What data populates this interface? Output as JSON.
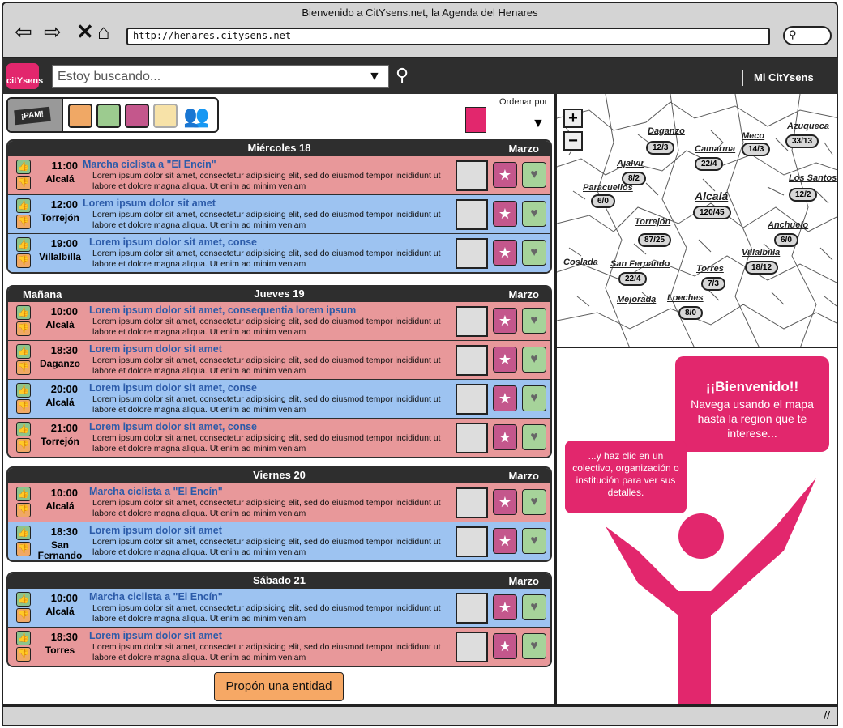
{
  "browser": {
    "title": "Bienvenido a CitYsens.net, la Agenda del Henares",
    "url": "http://henares.citysens.net"
  },
  "app": {
    "logo_text": "citYsens",
    "search_placeholder": "Estoy buscando...",
    "my_link": "Mi CitYsens",
    "sort_label": "Ordenar por",
    "pam_label": "¡PAM!",
    "propose_button": "Propón una entidad"
  },
  "days": [
    {
      "left": "",
      "name": "Miércoles 18",
      "month": "Marzo",
      "events": [
        {
          "color": "red",
          "time": "11:00",
          "place": "Alcalá",
          "title": "Marcha ciclista a \"El Encín\"",
          "desc": "Lorem ipsum dolor sit amet, consectetur adipisicing elit, sed do eiusmod tempor incididunt ut labore et dolore magna aliqua. Ut enim ad minim veniam"
        },
        {
          "color": "blue",
          "time": "12:00",
          "place": "Torrejón",
          "title": "Lorem ipsum dolor sit amet",
          "desc": "Lorem ipsum dolor sit amet, consectetur adipisicing elit, sed do eiusmod tempor incididunt ut labore et dolore magna aliqua. Ut enim ad minim veniam"
        },
        {
          "color": "blue",
          "time": "19:00",
          "place": "Villalbilla",
          "title": "Lorem ipsum dolor sit amet, conse",
          "desc": "Lorem ipsum dolor sit amet, consectetur adipisicing elit, sed do eiusmod tempor incididunt ut labore et dolore magna aliqua. Ut enim ad minim veniam"
        }
      ]
    },
    {
      "left": "Mañana",
      "name": "Jueves 19",
      "month": "Marzo",
      "events": [
        {
          "color": "red",
          "time": "10:00",
          "place": "Alcalá",
          "title": "Lorem ipsum dolor sit amet, consequentia lorem ipsum",
          "desc": "Lorem ipsum dolor sit amet, consectetur adipisicing elit, sed do eiusmod tempor incididunt ut labore et dolore magna aliqua. Ut enim ad minim veniam"
        },
        {
          "color": "red",
          "time": "18:30",
          "place": "Daganzo",
          "title": "Lorem ipsum dolor sit amet",
          "desc": "Lorem ipsum dolor sit amet, consectetur adipisicing elit, sed do eiusmod tempor incididunt ut labore et dolore magna aliqua. Ut enim ad minim veniam"
        },
        {
          "color": "blue",
          "time": "20:00",
          "place": "Alcalá",
          "title": "Lorem ipsum dolor sit amet, conse",
          "desc": "Lorem ipsum dolor sit amet, consectetur adipisicing elit, sed do eiusmod tempor incididunt ut labore et dolore magna aliqua. Ut enim ad minim veniam"
        },
        {
          "color": "red",
          "time": "21:00",
          "place": "Torrejón",
          "title": "Lorem ipsum dolor sit amet, conse",
          "desc": "Lorem ipsum dolor sit amet, consectetur adipisicing elit, sed do eiusmod tempor incididunt ut labore et dolore magna aliqua. Ut enim ad minim veniam"
        }
      ]
    },
    {
      "left": "",
      "name": "Viernes 20",
      "month": "Marzo",
      "events": [
        {
          "color": "red",
          "time": "10:00",
          "place": "Alcalá",
          "title": "Marcha ciclista a \"El Encín\"",
          "desc": "Lorem ipsum dolor sit amet, consectetur adipisicing elit, sed do eiusmod tempor incididunt ut labore et dolore magna aliqua. Ut enim ad minim veniam"
        },
        {
          "color": "blue",
          "time": "18:30",
          "place": "San Fernando",
          "title": "Lorem ipsum dolor sit amet",
          "desc": "Lorem ipsum dolor sit amet, consectetur adipisicing elit, sed do eiusmod tempor incididunt ut labore et dolore magna aliqua. Ut enim ad minim veniam"
        }
      ]
    },
    {
      "left": "",
      "name": "Sábado 21",
      "month": "Marzo",
      "events": [
        {
          "color": "blue",
          "time": "10:00",
          "place": "Alcalá",
          "title": "Marcha ciclista a \"El Encín\"",
          "desc": "Lorem ipsum dolor sit amet, consectetur adipisicing elit, sed do eiusmod tempor incididunt ut labore et dolore magna aliqua. Ut enim ad minim veniam"
        },
        {
          "color": "red",
          "time": "18:30",
          "place": "Torres",
          "title": "Lorem ipsum dolor sit amet",
          "desc": "Lorem ipsum dolor sit amet, consectetur adipisicing elit, sed do eiusmod tempor incididunt ut labore et dolore magna aliqua. Ut enim ad minim veniam"
        }
      ]
    }
  ],
  "map": {
    "towns": [
      {
        "name": "Daganzo",
        "count": "12/3"
      },
      {
        "name": "Meco",
        "count": "14/3"
      },
      {
        "name": "Azuqueca",
        "count": "33/13"
      },
      {
        "name": "Ajalvir",
        "count": "8/2"
      },
      {
        "name": "Camarma",
        "count": "22/4"
      },
      {
        "name": "Paracuellos",
        "count": "6/0"
      },
      {
        "name": "Alcalá",
        "count": "120/45"
      },
      {
        "name": "Los Santos",
        "count": "12/2"
      },
      {
        "name": "Torrejón",
        "count": "87/25"
      },
      {
        "name": "Anchuelo",
        "count": "6/0"
      },
      {
        "name": "Coslada",
        "count": ""
      },
      {
        "name": "San Fernando",
        "count": "22/4"
      },
      {
        "name": "Torres",
        "count": "7/3"
      },
      {
        "name": "Villalbilla",
        "count": "18/12"
      },
      {
        "name": "Mejorada",
        "count": ""
      },
      {
        "name": "Loeches",
        "count": "8/0"
      }
    ]
  },
  "welcome": {
    "title": "¡¡Bienvenido!!",
    "text": "Navega usando el mapa hasta la region que te interese...",
    "hint": "...y haz clic en un colectivo, organización o institución para ver sus detalles."
  },
  "colors": {
    "brand": "#e2276d",
    "red_row": "#e8989a",
    "blue_row": "#9dc3f1",
    "dark": "#2e2e2e"
  }
}
